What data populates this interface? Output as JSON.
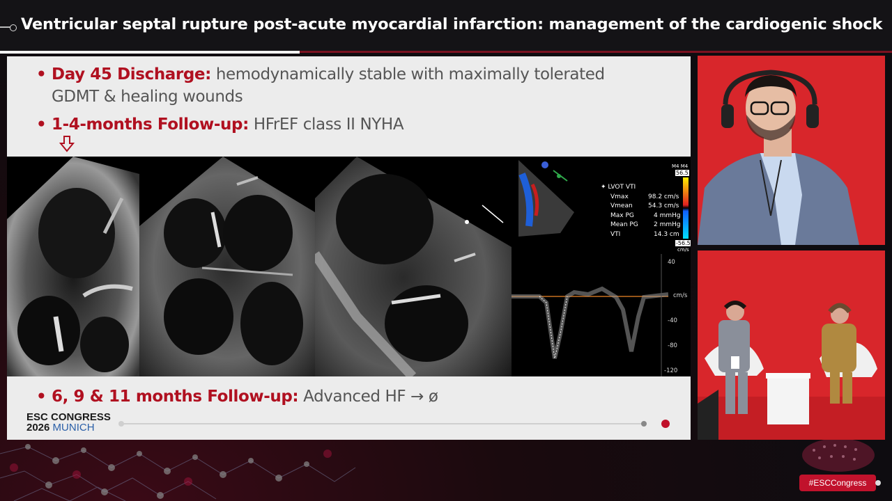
{
  "header": {
    "title": "Ventricular septal rupture post-acute myocardial infarction: management of the cardiogenic shock"
  },
  "slide": {
    "bullets": [
      {
        "label": "Day 45 Discharge:",
        "text_line1": "hemodynamically stable with maximally tolerated",
        "text_line2": "GDMT & healing wounds"
      },
      {
        "label": "1-4-months Follow-up:",
        "text": "HFrEF class II NYHA"
      },
      {
        "label": "6, 9 & 11 months Follow-up:",
        "text": "Advanced HF → ø"
      }
    ],
    "bullet_glyph": "•",
    "doppler": {
      "label": "LVOT VTI",
      "measurements": [
        {
          "name": "Vmax",
          "value": "98.2 cm/s"
        },
        {
          "name": "Vmean",
          "value": "54.3 cm/s"
        },
        {
          "name": "Max PG",
          "value": "4 mmHg"
        },
        {
          "name": "Mean PG",
          "value": "2 mmHg"
        },
        {
          "name": "VTI",
          "value": "14.3 cm"
        }
      ],
      "scale_top": "M4 M4",
      "scale_max": "56.5",
      "scale_min": "-56.5",
      "scale_unit": "cm/s",
      "axis_ticks": [
        "40",
        "cm/s",
        "-40",
        "-80",
        "-120"
      ]
    },
    "logo": {
      "line1": "ESC CONGRESS",
      "line2_bold": "2026",
      "line2_light": "MUNICH"
    }
  },
  "footer": {
    "hashtag": "#ESCCongress"
  },
  "colors": {
    "accent_red": "#b01020",
    "brand_red": "#c1122c",
    "video_bg": "#d8262b"
  },
  "icons": [
    "down-arrow-icon",
    "title-marker-icon"
  ]
}
